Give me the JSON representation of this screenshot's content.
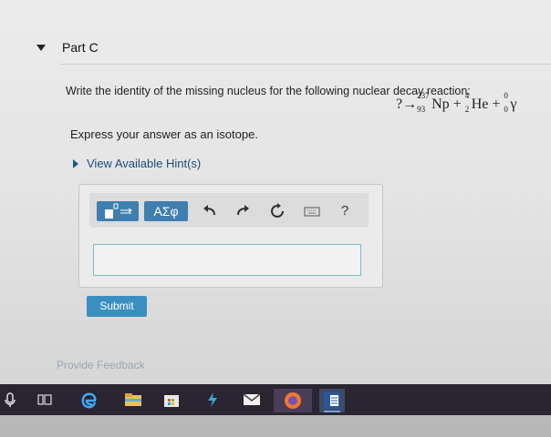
{
  "part": {
    "title": "Part C"
  },
  "question": {
    "text": "Write the identity of the missing nucleus for the following nuclear decay reaction:",
    "equation": {
      "unknown": "?",
      "arrow": "→",
      "np_mass": "237",
      "np_atomic": "93",
      "np_symbol": "Np",
      "plus1": "+",
      "he_mass": "4",
      "he_atomic": "2",
      "he_symbol": "He",
      "plus2": "+",
      "gamma_mass": "0",
      "gamma_atomic": "0",
      "gamma_symbol": "γ"
    }
  },
  "instruction": "Express your answer as an isotope.",
  "hints": {
    "label": "View Available Hint(s)"
  },
  "toolbar": {
    "greek_label": "ΑΣφ",
    "help_label": "?"
  },
  "submit_label": "Submit",
  "feedback_label": "Provide Feedback",
  "colors": {
    "accent": "#3f7fb0",
    "submit": "#3a8fc0",
    "link": "#1a4c7a"
  }
}
